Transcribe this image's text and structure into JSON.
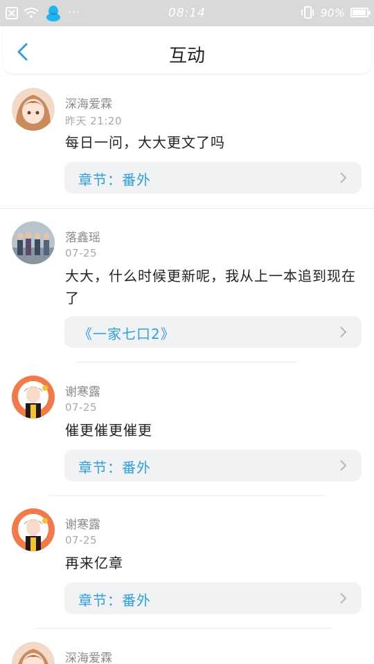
{
  "status_bar": {
    "time": "08:14",
    "battery": "90%",
    "battery_level": 0.9,
    "dots": "···"
  },
  "header": {
    "title": "互动"
  },
  "colors": {
    "accent": "#2f9fe0",
    "chip_bg": "#f1f2f4",
    "status_bar_bg": "#d9d9d9"
  },
  "comments": [
    {
      "username": "深海爱霖",
      "time": "昨天 21:20",
      "content": "每日一问，大大更文了吗",
      "link": "章节：番外"
    },
    {
      "username": "落鑫瑶",
      "time": "07-25",
      "content": "大大，什么时候更新呢，我从上一本追到现在了",
      "link": "《一家七口2》"
    },
    {
      "username": "谢寒露",
      "time": "07-25",
      "content": "催更催更催更",
      "link": "章节：番外"
    },
    {
      "username": "谢寒露",
      "time": "07-25",
      "content": "再来亿章",
      "link": "章节：番外"
    },
    {
      "username": "深海爱霖"
    }
  ]
}
